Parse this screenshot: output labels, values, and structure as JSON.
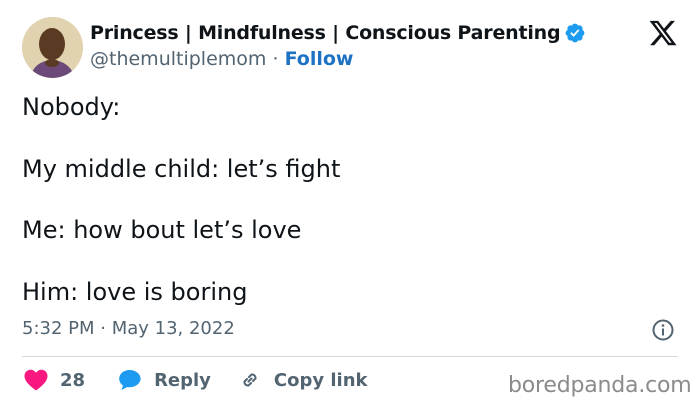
{
  "tweet": {
    "display_name": "Princess | Mindfulness | Conscious Parenting",
    "handle": "@themultiplemom",
    "separator": "·",
    "follow_label": "Follow",
    "lines": [
      "Nobody:",
      "My middle child: let’s fight",
      "Me: how bout let’s love",
      "Him: love is boring"
    ],
    "timestamp": "5:32 PM · May 13, 2022",
    "likes": "28",
    "reply_label": "Reply",
    "copy_link_label": "Copy link"
  },
  "watermark": "boredpanda.com",
  "icons": {
    "verified": "verified-badge-icon",
    "logo": "x-logo-icon",
    "info": "info-icon",
    "heart": "heart-icon",
    "reply": "speech-bubble-icon",
    "link": "link-icon"
  },
  "colors": {
    "heart": "#f91880",
    "reply": "#1d9bf0",
    "verified": "#1d9bf0",
    "follow": "#1d72c4",
    "muted": "#536471"
  }
}
